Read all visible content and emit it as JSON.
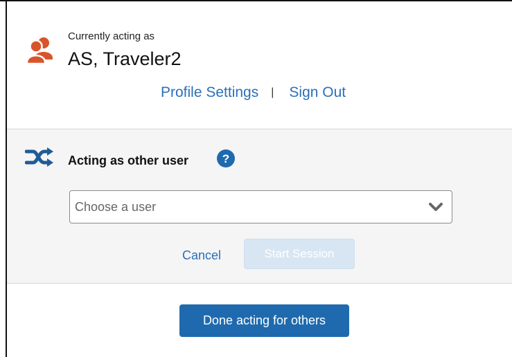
{
  "header": {
    "acting_label": "Currently acting as",
    "user_name": "AS, Traveler2",
    "profile_settings": "Profile Settings",
    "separator": "|",
    "sign_out": "Sign Out"
  },
  "acting_section": {
    "title": "Acting as other user",
    "help_icon": "question-circle-icon",
    "select": {
      "placeholder": "Choose a user",
      "value": ""
    },
    "cancel": "Cancel",
    "start_session": "Start Session"
  },
  "footer": {
    "done_button": "Done acting for others"
  },
  "colors": {
    "link": "#2a70b8",
    "accent": "#1f6aae",
    "avatar": "#d9542c",
    "disabled_button": "#d8e6f3",
    "section_bg": "#f5f5f5"
  }
}
